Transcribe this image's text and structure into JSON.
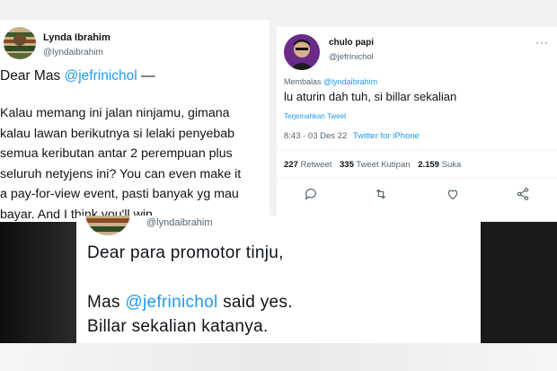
{
  "tweet_left": {
    "name": "Lynda Ibrahim",
    "handle": "@lyndaibrahim",
    "greeting_prefix": "Dear Mas ",
    "greeting_mention": "@jefrinichol",
    "greeting_suffix": " —",
    "body_lines": [
      "Kalau memang ini jalan ninjamu, gimana",
      "kalau lawan berikutnya si lelaki penyebab",
      "semua keributan antar 2 perempuan plus",
      "seluruh netyjens ini? You can even make it",
      "a pay-for-view event, pasti banyak yg mau",
      "bayar. And I think you'll win."
    ]
  },
  "tweet_right": {
    "name": "chulo papi",
    "handle": "@jefrinichol",
    "reply_prefix": "Membalas ",
    "reply_mention": "@lyndaibrahim",
    "text": "lu aturin dah tuh, si billar sekalian",
    "translate": "Terjemahkan Tweet",
    "time": "8:43 · 03 Des 22",
    "source": "Twitter for iPhone",
    "retweets_value": "227",
    "retweets_label": "Retweet",
    "quotes_value": "335",
    "quotes_label": "Tweet Kutipan",
    "likes_value": "2.159",
    "likes_label": "Suka"
  },
  "tweet_bottom": {
    "handle": "@lyndaibrahim",
    "line1": "Dear para promotor tinju,",
    "line2_prefix": "Mas ",
    "line2_mention": "@jefrinichol",
    "line2_suffix": " said yes.",
    "line3": "Billar sekalian katanya."
  },
  "icons": [
    "more-icon",
    "reply-icon",
    "retweet-icon",
    "like-icon",
    "share-icon"
  ],
  "colors": {
    "link": "#1d9bf0",
    "muted": "#536471",
    "text": "#0f1419",
    "dark_band": "#1a1a1a"
  }
}
